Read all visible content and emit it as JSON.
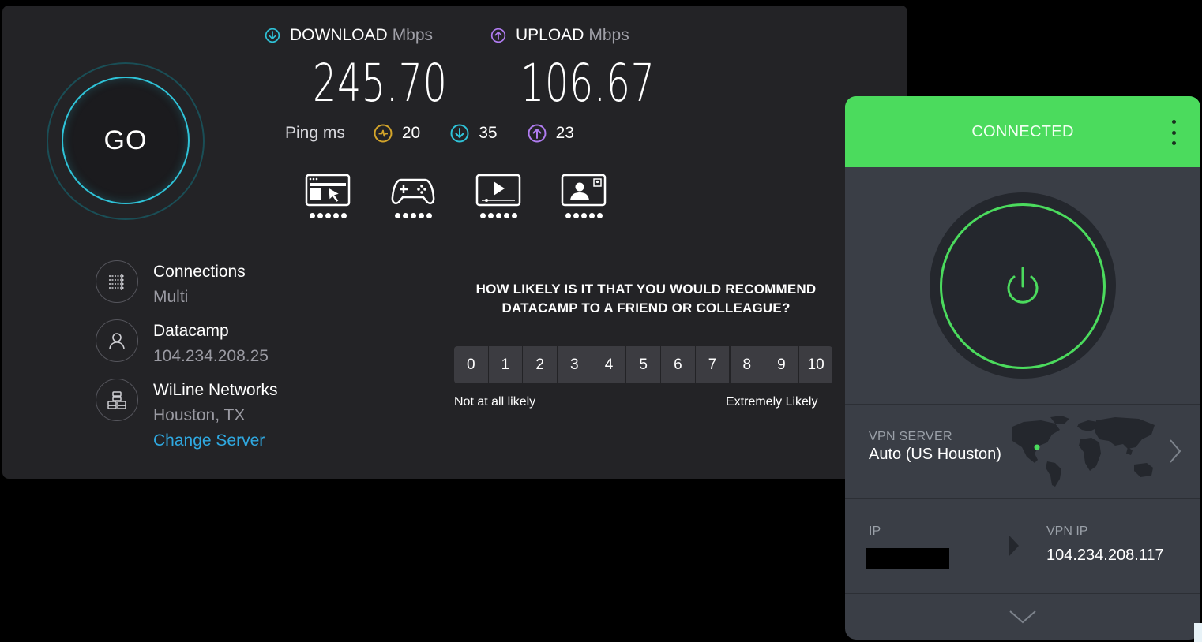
{
  "speedtest": {
    "go_label": "GO",
    "download": {
      "label": "DOWNLOAD",
      "unit": "Mbps",
      "value": "245.70",
      "icon": "arrow-down-circle-icon",
      "color": "#2fc3d8"
    },
    "upload": {
      "label": "UPLOAD",
      "unit": "Mbps",
      "value": "106.67",
      "icon": "arrow-up-circle-icon",
      "color": "#b07cf0"
    },
    "ping": {
      "label": "Ping ms",
      "idle": "20",
      "download": "35",
      "upload": "23",
      "colors": {
        "idle": "#d4a52a",
        "download": "#2fc3d8",
        "upload": "#b07cf0"
      }
    },
    "quality_icons": [
      "web-browsing-icon",
      "gaming-icon",
      "video-streaming-icon",
      "video-chat-icon"
    ],
    "info": {
      "connections": {
        "title": "Connections",
        "value": "Multi"
      },
      "host": {
        "title": "Datacamp",
        "value": "104.234.208.25"
      },
      "server": {
        "title": "WiLine Networks",
        "value": "Houston, TX",
        "change": "Change Server"
      }
    },
    "survey": {
      "question": "HOW LIKELY IS IT THAT YOU WOULD RECOMMEND DATACAMP TO A FRIEND OR COLLEAGUE?",
      "scores": [
        "0",
        "1",
        "2",
        "3",
        "4",
        "5",
        "6",
        "7",
        "8",
        "9",
        "10"
      ],
      "low_label": "Not at all likely",
      "high_label": "Extremely Likely"
    }
  },
  "vpn": {
    "status": "CONNECTED",
    "accent": "#4bdb5d",
    "server_label": "VPN SERVER",
    "server_value": "Auto (US Houston)",
    "ip_label": "IP",
    "vpn_ip_label": "VPN IP",
    "vpn_ip_value": "104.234.208.117"
  }
}
